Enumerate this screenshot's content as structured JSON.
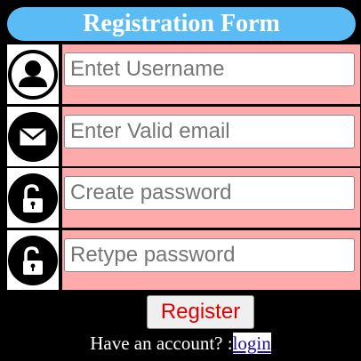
{
  "form": {
    "title": "Registration Form",
    "fields": [
      {
        "icon": "user-icon",
        "placeholder": "Entet Username",
        "value": ""
      },
      {
        "icon": "envelope-icon",
        "placeholder": "Enter Valid email",
        "value": ""
      },
      {
        "icon": "unlock-icon",
        "placeholder": "Create password",
        "value": ""
      },
      {
        "icon": "unlock-icon",
        "placeholder": "Retype password",
        "value": ""
      }
    ],
    "register_label": "Register",
    "account_prompt": "Have an account? :",
    "login_label": "login"
  },
  "colors": {
    "background": "#000000",
    "title_bar": "#5bbcf5",
    "field_background": "#ffaaaa",
    "register_text": "#e00000",
    "link": "#1a0dab"
  }
}
